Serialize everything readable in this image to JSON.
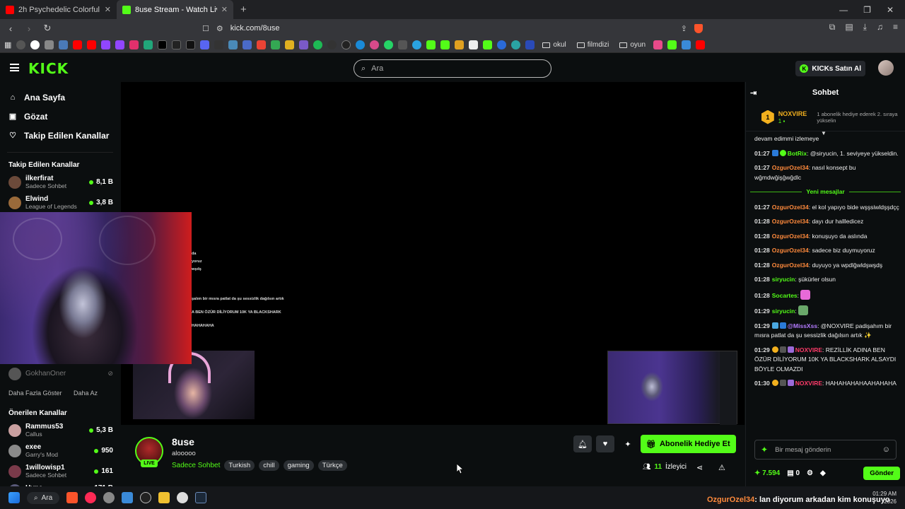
{
  "browser": {
    "tabs": [
      {
        "title": "2h Psychedelic Colorful Neon Backgr",
        "active": false,
        "favicon_color": "#ff0000"
      },
      {
        "title": "8use Stream - Watch Live on Kick",
        "active": true,
        "favicon_color": "#53fc18"
      }
    ],
    "url": "kick.com/8use",
    "bookmark_folders": [
      "okul",
      "filmdizi",
      "oyun"
    ]
  },
  "header": {
    "logo": "KICK",
    "search_placeholder": "Ara",
    "buy_kicks_label": "KICKs Satın Al"
  },
  "sidebar": {
    "nav": [
      {
        "label": "Ana Sayfa",
        "icon": "home-icon"
      },
      {
        "label": "Gözat",
        "icon": "browse-icon"
      },
      {
        "label": "Takip Edilen Kanallar",
        "icon": "heart-icon"
      }
    ],
    "followed_title": "Takip Edilen Kanallar",
    "followed": [
      {
        "name": "ilkerfirat",
        "category": "Sadece Sohbet",
        "viewers": "8,1 B",
        "color": "#6b4a3a"
      },
      {
        "name": "Elwind",
        "category": "League of Legends",
        "viewers": "3,8 B",
        "color": "#9a6a3a"
      }
    ],
    "offline_channel": "GokhanOner",
    "show_more": "Daha Fazla Göster",
    "show_less": "Daha Az",
    "recommended_title": "Önerilen Kanallar",
    "recommended": [
      {
        "name": "Rammus53",
        "category": "Callus",
        "viewers": "5,3 B",
        "color": "#c9a0a0"
      },
      {
        "name": "exee",
        "category": "Garry's Mod",
        "viewers": "950",
        "color": "#8a8a8a"
      },
      {
        "name": "1willowisp1",
        "category": "Sadece Sohbet",
        "viewers": "161",
        "color": "#7a3a4a"
      },
      {
        "name": "Hype",
        "category": "",
        "viewers": "171 B",
        "color": "#5a5a7a"
      }
    ]
  },
  "player": {
    "overlay_lines": [
      "da",
      "yoruz",
      "wşdş",
      "şalım bir mısra patlat da şu sessizlik dağılsın artık",
      "A BEN ÖZÜR DİLİYORUM 10K YA BLACKSHARK",
      "HAHAHAHA"
    ]
  },
  "stream": {
    "streamer": "8use",
    "live_label": "LIVE",
    "title": "alooooo",
    "category": "Sadece Sohbet",
    "tags": [
      "Turkish",
      "chill",
      "gaming",
      "Türkçe"
    ],
    "subscribe_gift_label": "Abonelik Hediye Et",
    "viewer_count": "11",
    "viewer_label": "İzleyici"
  },
  "chat": {
    "title": "Sohbet",
    "pinned": {
      "rank": "1",
      "name": "NOXVIRE",
      "count": "1",
      "note": "1 abonelik hediye ederek 2. sıraya yükselin"
    },
    "messages_before": [
      {
        "time": "",
        "user": "",
        "user_color": "#ffffff",
        "text": "devam edimmi izlemeye"
      },
      {
        "time": "01:27",
        "user": "BotRix",
        "user_color": "#53fc18",
        "text": "@siryucin, 1. seviyeye yükseldin."
      },
      {
        "time": "01:27",
        "user": "OzgurOzel34",
        "user_color": "#ff8a3c",
        "text": "nasıl konsept bu wğmdwğişğwğdlc"
      }
    ],
    "new_messages_label": "Yeni mesajlar",
    "messages_after": [
      {
        "time": "01:27",
        "user": "OzgurOzel34",
        "user_color": "#ff8a3c",
        "text": "el kol yapıyo bide wşşsiwldşşdçç"
      },
      {
        "time": "01:28",
        "user": "OzgurOzel34",
        "user_color": "#ff8a3c",
        "text": "dayı dur hallledicez"
      },
      {
        "time": "01:28",
        "user": "OzgurOzel34",
        "user_color": "#ff8a3c",
        "text": "konuşuyo da aslında"
      },
      {
        "time": "01:28",
        "user": "OzgurOzel34",
        "user_color": "#ff8a3c",
        "text": "sadece biz duymuyoruz"
      },
      {
        "time": "01:28",
        "user": "OzgurOzel34",
        "user_color": "#ff8a3c",
        "text": "duyuyo ya wpdlğwldşwşdş"
      },
      {
        "time": "01:28",
        "user": "siryucin",
        "user_color": "#53fc18",
        "text": "şükürler olsun"
      },
      {
        "time": "01:28",
        "user": "Socartes",
        "user_color": "#53fc18",
        "text": "",
        "emote": "#e86ad8"
      },
      {
        "time": "01:29",
        "user": "siryucin",
        "user_color": "#53fc18",
        "text": "",
        "emote": "#6aa86a"
      },
      {
        "time": "01:29",
        "user": "@MissXss",
        "user_color": "#b47bff",
        "text": "@NOXVIRE padişahım bir mısra patlat da şu sessizlik dağılsın artık ✨"
      },
      {
        "time": "01:29",
        "user": "NOXVIRE",
        "user_color": "#ff3b6a",
        "text": "REZİLLİK ADINA BEN ÖZÜR DİLİYORUM 10K YA BLACKSHARK ALSAYDI BÖYLE OLMAZDI"
      },
      {
        "time": "01:30",
        "user": "NOXVIRE",
        "user_color": "#ff3b6a",
        "text": "HAHAHAHAHAAHAHAHA"
      }
    ],
    "input_placeholder": "Bir mesaj gönderin",
    "points": "7.594",
    "tickets": "0",
    "send_label": "Gönder"
  },
  "taskbar": {
    "search_label": "Ara",
    "time": "01:29 AM",
    "date": "2026",
    "marquee_user": "OzgurOzel34",
    "marquee_text": ": lan diyorum arkadan kim konuşuyo"
  },
  "colors": {
    "brand": "#53fc18",
    "background": "#0b0e0f"
  }
}
